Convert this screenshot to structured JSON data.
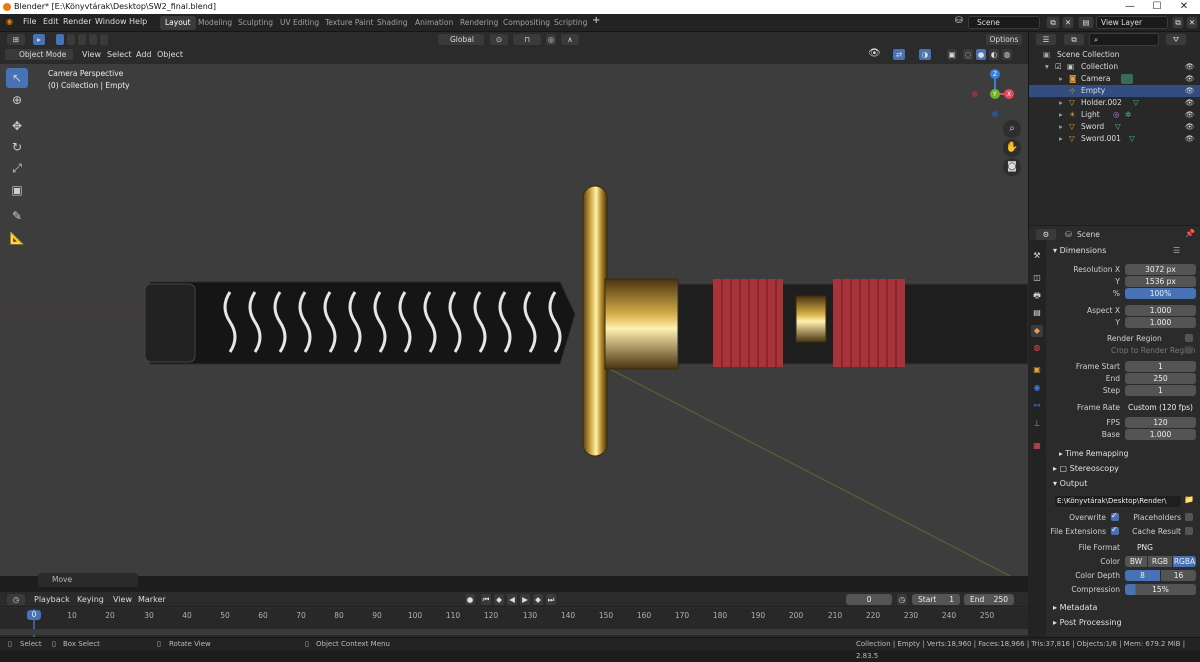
{
  "window": {
    "title": "Blender* [E:\\Könyvtárak\\Desktop\\SW2_final.blend]",
    "minimize": "—",
    "maximize": "☐",
    "close": "✕"
  },
  "menu": {
    "items": [
      "File",
      "Edit",
      "Render",
      "Window",
      "Help"
    ]
  },
  "workspaces": [
    "Layout",
    "Modeling",
    "Sculpting",
    "UV Editing",
    "Texture Paint",
    "Shading",
    "Animation",
    "Rendering",
    "Compositing",
    "Scripting"
  ],
  "workspace_add": "+",
  "scene": {
    "name": "Scene",
    "view_layer": "View Layer"
  },
  "viewport_header": {
    "mode": "Object Mode",
    "menus": [
      "View",
      "Select",
      "Add",
      "Object"
    ],
    "orientation": "Global",
    "options": "Options"
  },
  "viewport": {
    "camera_label": "Camera Perspective",
    "collection_label": "(0) Collection | Empty",
    "gizmo": {
      "z": "Z",
      "y": "Y",
      "x": "X"
    }
  },
  "last_operator": "Move",
  "timeline": {
    "menus": [
      "Playback",
      "Keying",
      "View",
      "Marker"
    ],
    "current_frame": "0",
    "start_label": "Start",
    "start": "1",
    "end_label": "End",
    "end": "250",
    "ticks": [
      "0",
      "10",
      "20",
      "30",
      "40",
      "50",
      "60",
      "70",
      "80",
      "90",
      "100",
      "110",
      "120",
      "130",
      "140",
      "150",
      "160",
      "170",
      "180",
      "190",
      "200",
      "210",
      "220",
      "230",
      "240",
      "250"
    ]
  },
  "statusbar": {
    "select": "Select",
    "box_select": "Box Select",
    "rotate": "Rotate View",
    "context": "Object Context Menu",
    "stats": "Collection | Empty | Verts:18,960 | Faces:18,966 | Tris:37,816 | Objects:1/6 | Mem: 679.2 MiB | 2.83.5"
  },
  "outliner": {
    "root": "Scene Collection",
    "collection": "Collection",
    "items": [
      "Camera",
      "Empty",
      "Holder.002",
      "Light",
      "Sword",
      "Sword.001"
    ]
  },
  "properties": {
    "context": "Scene",
    "dimensions": {
      "title": "Dimensions",
      "res_x_label": "Resolution X",
      "res_x": "3072 px",
      "res_y_label": "Y",
      "res_y": "1536 px",
      "res_pct_label": "%",
      "res_pct": "100%",
      "aspect_x_label": "Aspect X",
      "aspect_x": "1.000",
      "aspect_y_label": "Y",
      "aspect_y": "1.000",
      "render_region": "Render Region",
      "crop": "Crop to Render Region",
      "frame_start_label": "Frame Start",
      "frame_start": "1",
      "end_label": "End",
      "end": "250",
      "step_label": "Step",
      "step": "1",
      "frame_rate_label": "Frame Rate",
      "frame_rate": "Custom (120 fps)",
      "fps_label": "FPS",
      "fps": "120",
      "base_label": "Base",
      "base": "1.000"
    },
    "time_remapping": "Time Remapping",
    "stereoscopy": "Stereoscopy",
    "output": {
      "title": "Output",
      "path": "E:\\Könyvtárak\\Desktop\\Render\\",
      "overwrite": "Overwrite",
      "placeholders": "Placeholders",
      "file_extensions": "File Extensions",
      "cache_result": "Cache Result",
      "file_format_label": "File Format",
      "file_format": "PNG",
      "color_label": "Color",
      "color_bw": "BW",
      "color_rgb": "RGB",
      "color_rgba": "RGBA",
      "depth_label": "Color Depth",
      "depth_8": "8",
      "depth_16": "16",
      "compression_label": "Compression",
      "compression": "15%"
    },
    "metadata": "Metadata",
    "post_processing": "Post Processing"
  },
  "colors": {
    "accent": "#4772b3",
    "selected_row": "#334d80",
    "viewport_bg": "#3d3d3d",
    "x_axis": "#e04a5b",
    "y_axis": "#6fb329",
    "z_axis": "#3a7fdc"
  }
}
